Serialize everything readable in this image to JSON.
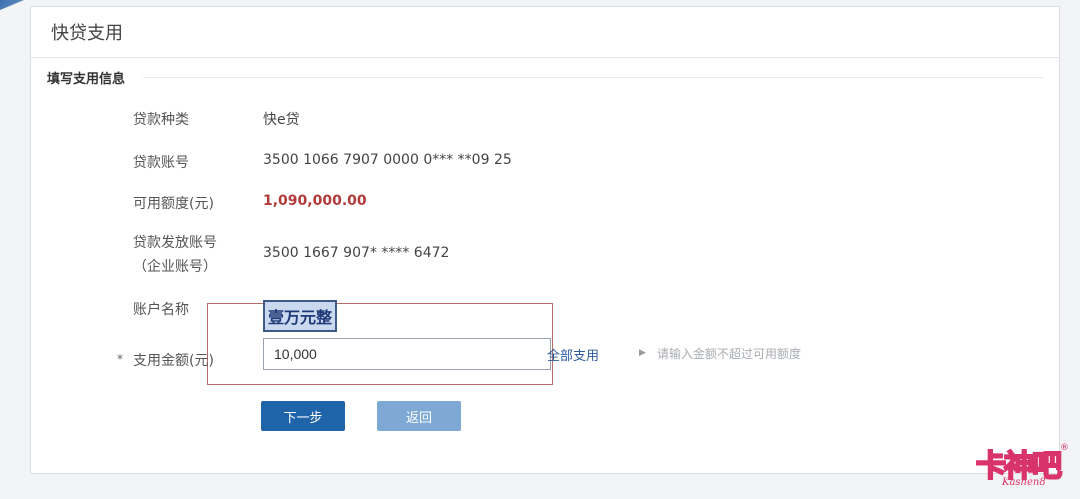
{
  "header": {
    "title": "快贷支用"
  },
  "section": {
    "title": "填写支用信息"
  },
  "fields": {
    "loan_type": {
      "label": "贷款种类",
      "value": "快e贷"
    },
    "loan_account": {
      "label": "贷款账号",
      "value": "3500 1066 7907 0000 0*** **09 25"
    },
    "available_limit": {
      "label": "可用额度(元)",
      "value": "1,090,000.00"
    },
    "disburse_account": {
      "label_line1": "贷款发放账号",
      "label_line2": "（企业账号）",
      "value": "3500 1667 907* **** 6472"
    },
    "account_name": {
      "label": "账户名称"
    }
  },
  "amount": {
    "required_mark": "*",
    "label": "支用金额(元)",
    "value": "10,000",
    "in_words": "壹万元整",
    "all_use_link": "全部支用",
    "hint": "请输入金额不超过可用额度"
  },
  "buttons": {
    "next": "下一步",
    "back": "返回"
  },
  "watermark": {
    "text": "卡神吧",
    "sub": "Kashen8",
    "reg": "®"
  },
  "colors": {
    "primary": "#1f63a8",
    "primary_light": "#7fa9d5",
    "limit_red": "#b23a3a",
    "watermark": "#d9336b"
  }
}
